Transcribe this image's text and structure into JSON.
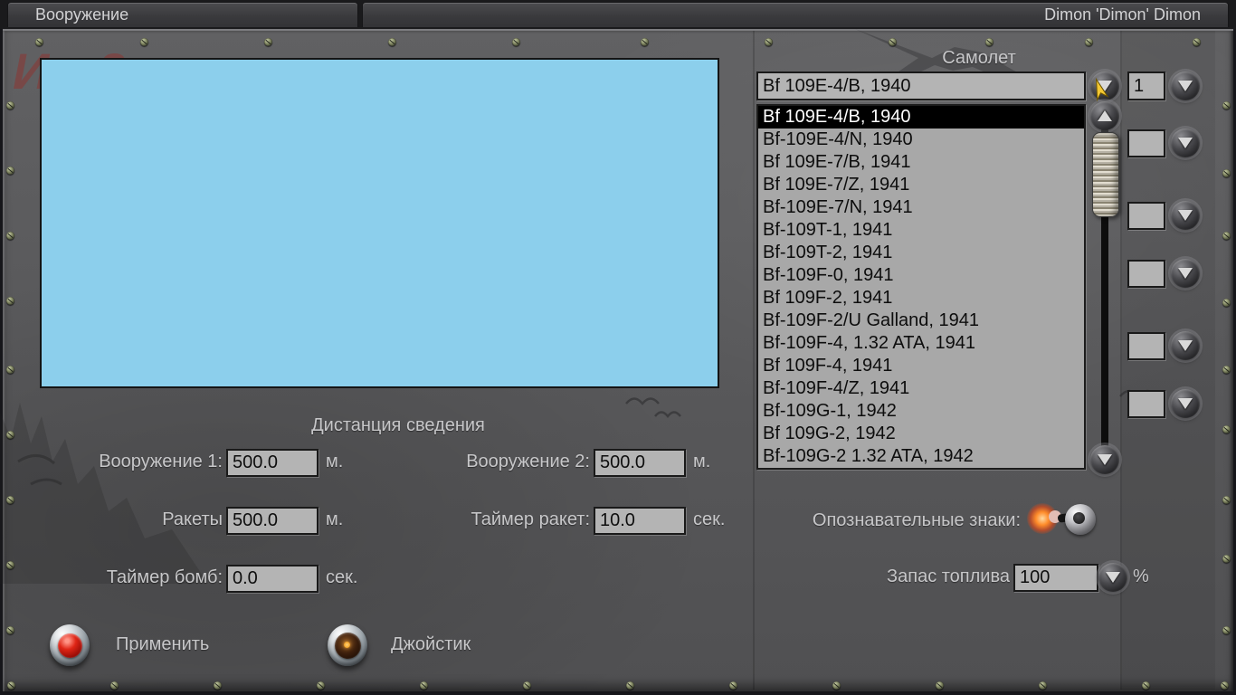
{
  "titlebar": {
    "armament_tab": "Вооружение",
    "player_name": "Dimon 'Dimon' Dimon"
  },
  "aircraft": {
    "label": "Самолет",
    "selected": "Bf 109E-4/B, 1940",
    "selected_index": 0,
    "count": "1",
    "options": [
      "Bf 109E-4/B, 1940",
      "Bf-109E-4/N, 1940",
      "Bf 109E-7/B, 1941",
      "Bf 109E-7/Z, 1941",
      "Bf-109E-7/N, 1941",
      "Bf-109T-1, 1941",
      "Bf-109T-2, 1941",
      "Bf-109F-0, 1941",
      "Bf 109F-2, 1941",
      "Bf-109F-2/U Galland, 1941",
      "Bf-109F-4, 1.32 ATA, 1941",
      "Bf 109F-4, 1941",
      "Bf-109F-4/Z, 1941",
      "Bf-109G-1, 1942",
      "Bf 109G-2, 1942",
      "Bf-109G-2 1.32 ATA, 1942"
    ]
  },
  "convergence": {
    "title": "Дистанция сведения",
    "weapon1": {
      "label": "Вооружение 1:",
      "value": "500.0",
      "unit": "м."
    },
    "weapon2": {
      "label": "Вооружение 2:",
      "value": "500.0",
      "unit": "м."
    },
    "rockets": {
      "label": "Ракеты",
      "value": "500.0",
      "unit": "м."
    },
    "rocket_timer": {
      "label": "Таймер ракет:",
      "value": "10.0",
      "unit": "сек."
    },
    "bomb_timer": {
      "label": "Таймер бомб:",
      "value": "0.0",
      "unit": "сек."
    }
  },
  "markings": {
    "label": "Опознавательные знаки:",
    "state": "on"
  },
  "fuel": {
    "label": "Запас топлива",
    "value": "100",
    "unit": "%"
  },
  "actions": {
    "apply": "Применить",
    "joystick": "Джойстик"
  },
  "icons": {
    "spinner_down": "down-triangle",
    "scroll_up": "up-triangle",
    "scroll_down": "down-triangle",
    "cursor": "yellow-arrow",
    "markings_toggle": "lit-toggle-switch",
    "apply_lamp": "red-lamp-button",
    "joystick_lamp": "dark-lamp-button"
  },
  "colors": {
    "preview_sky": "#8CCFEC",
    "selection_bg": "#000000",
    "selection_fg": "#FFFFFF",
    "apply_lamp": "#DF2516",
    "joystick_lamp_dot": "#F2A024",
    "toggle_glow": "#FF8C2A",
    "panel": "#59595B"
  }
}
